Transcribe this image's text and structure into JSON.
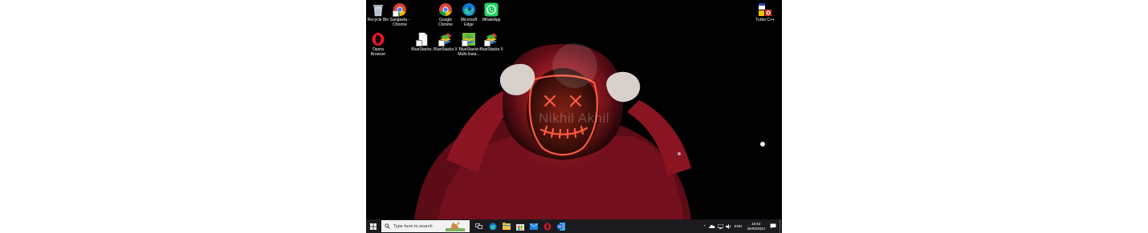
{
  "desktop": {
    "icons": [
      {
        "label": "Recycle Bin",
        "icon": "recycle-bin-icon"
      },
      {
        "label": "Sangeeta - Chrome",
        "icon": "chrome-icon"
      },
      {
        "label": "Google Chrome",
        "icon": "chrome-icon"
      },
      {
        "label": "Microsoft Edge",
        "icon": "edge-icon"
      },
      {
        "label": "WhatsApp",
        "icon": "whatsapp-icon"
      },
      {
        "label": "Turbo C++",
        "icon": "turbo-cpp-icon"
      },
      {
        "label": "Opera Browser",
        "icon": "opera-icon"
      },
      {
        "label": "BlueStacks...",
        "icon": "file-icon"
      },
      {
        "label": "BlueStacks X",
        "icon": "bluestacks-icon"
      },
      {
        "label": "BlueStacks Multi-Insta...",
        "icon": "bluestacks-icon"
      },
      {
        "label": "BlueStacks 5",
        "icon": "bluestacks-icon"
      }
    ],
    "wallpaper_watermark": "Nikhil Akhil"
  },
  "taskbar": {
    "search_placeholder": "Type here to search",
    "language": "ENG",
    "time": "16:54",
    "date": "26/08/2024",
    "apps": [
      "task-view-icon",
      "edge-icon",
      "file-explorer-icon",
      "store-icon",
      "mail-icon",
      "opera-icon",
      "word-icon"
    ]
  },
  "colors": {
    "taskbar": "#1b1b1f",
    "hoodie": "#8b1422",
    "mask_glow": "#ff5a3c"
  }
}
